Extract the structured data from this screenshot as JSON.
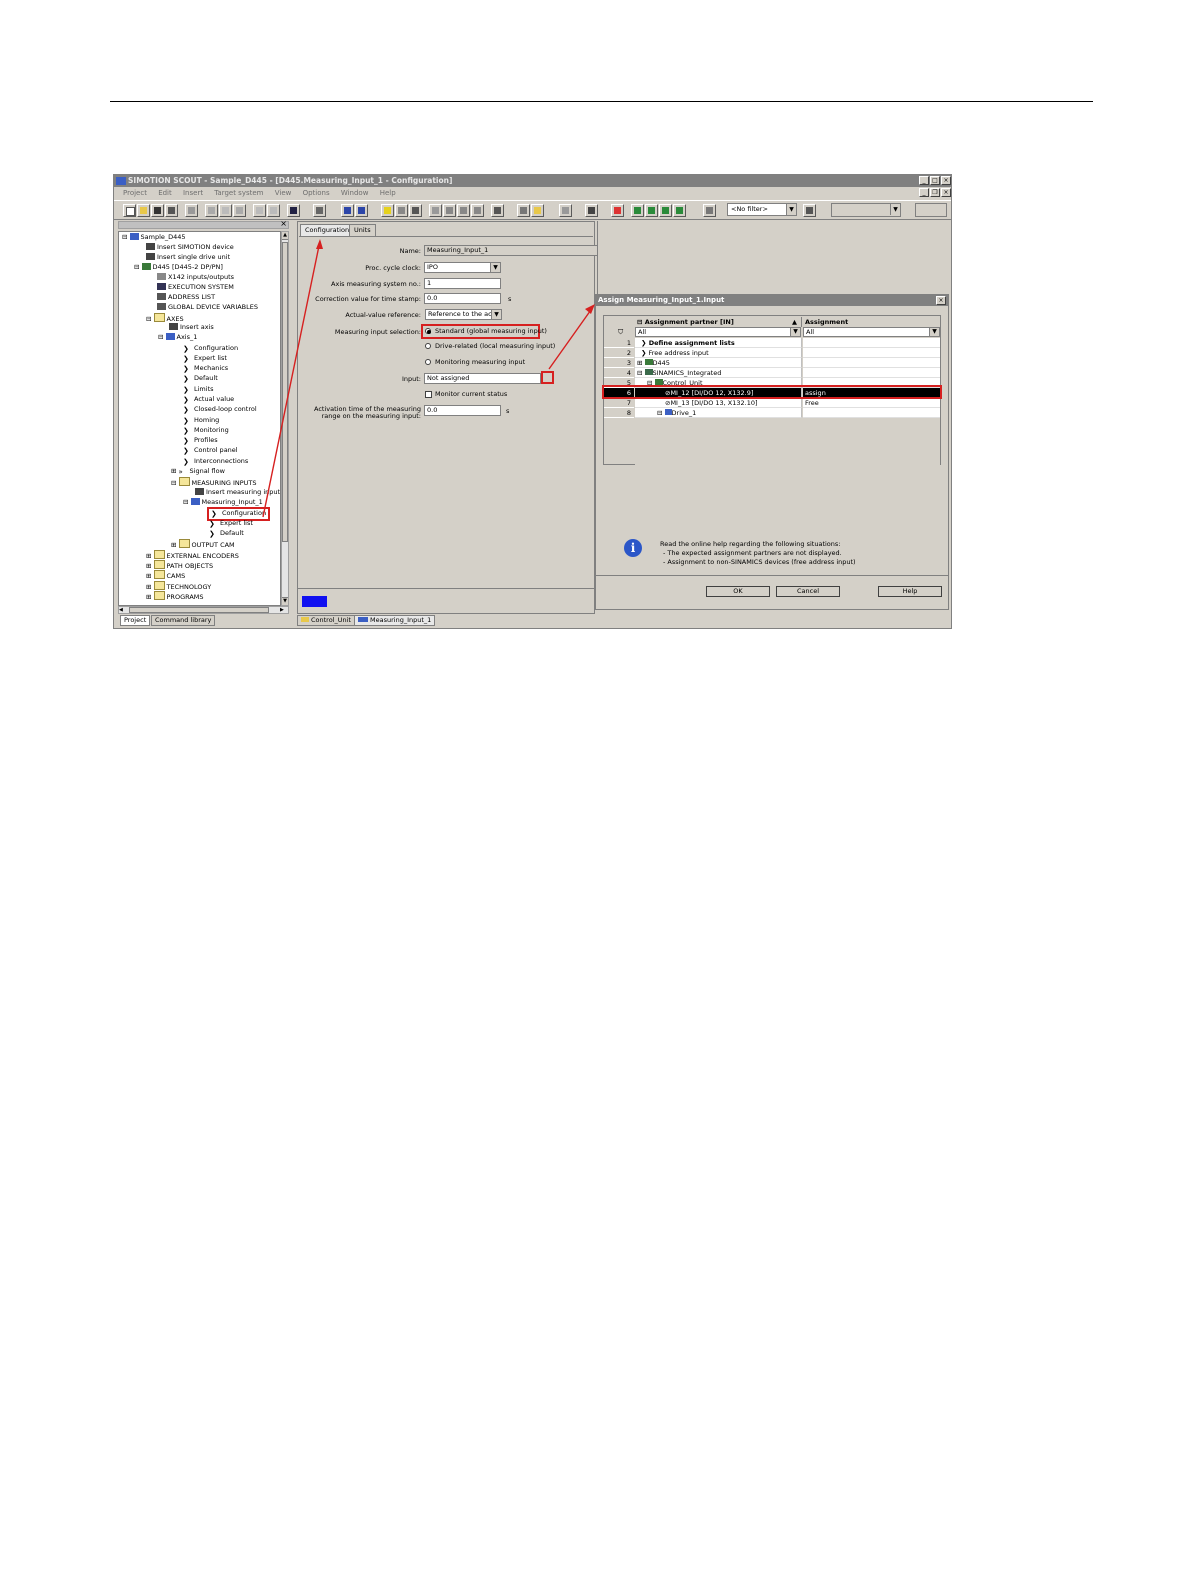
{
  "window": {
    "title": "SIMOTION SCOUT - Sample_D445 - [D445.Measuring_Input_1 - Configuration]",
    "menu": [
      "Project",
      "Edit",
      "Insert",
      "Target system",
      "View",
      "Options",
      "Window",
      "Help"
    ],
    "filter_value": "<No filter>"
  },
  "tree": {
    "items": [
      "Sample_D445",
      "Insert SIMOTION device",
      "Insert single drive unit",
      "D445 [D445-2 DP/PN]",
      "X142 inputs/outputs",
      "EXECUTION SYSTEM",
      "ADDRESS LIST",
      "GLOBAL DEVICE VARIABLES",
      "AXES",
      "Insert axis",
      "Axis_1",
      "Configuration",
      "Expert list",
      "Mechanics",
      "Default",
      "Limits",
      "Actual value",
      "Closed-loop control",
      "Homing",
      "Monitoring",
      "Profiles",
      "Control panel",
      "Interconnections",
      "Signal flow",
      "MEASURING INPUTS",
      "Insert measuring input",
      "Measuring_Input_1",
      "Configuration",
      "Expert list",
      "Default",
      "OUTPUT CAM",
      "EXTERNAL ENCODERS",
      "PATH OBJECTS",
      "CAMS",
      "TECHNOLOGY",
      "PROGRAMS"
    ],
    "tabs": [
      "Project",
      "Command library"
    ]
  },
  "config": {
    "tabs": [
      "Configuration",
      "Units"
    ],
    "name_label": "Name:",
    "name_value": "Measuring_Input_1",
    "proc_label": "Proc. cycle clock:",
    "proc_value": "IPO",
    "axis_label": "Axis measuring system no.:",
    "axis_value": "1",
    "corr_label": "Correction value for time stamp:",
    "corr_value": "0.0",
    "corr_unit": "s",
    "avr_label": "Actual-value reference:",
    "avr_value": "Reference to the actu",
    "mis_label": "Measuring input selection:",
    "radio_standard": "Standard (global measuring input)",
    "radio_drive": "Drive-related (local measuring input)",
    "radio_monitor": "Monitoring measuring input",
    "input_label": "Input:",
    "input_value": "Not assigned",
    "monitor_label": "Monitor current status",
    "act_label1": "Activation time of the measuring",
    "act_label2": "range on the measuring input:",
    "act_value": "0.0",
    "act_unit": "s"
  },
  "dialog": {
    "title": "Assign Measuring_Input_1.Input",
    "col1": "Assignment partner [IN]",
    "col2": "Assignment",
    "filter1": "All",
    "filter2": "All",
    "rows": [
      {
        "num": "1",
        "partner": "Define assignment lists",
        "assign": ""
      },
      {
        "num": "2",
        "partner": "Free address input",
        "assign": ""
      },
      {
        "num": "3",
        "partner": "D445",
        "assign": ""
      },
      {
        "num": "4",
        "partner": "SINAMICS_Integrated",
        "assign": ""
      },
      {
        "num": "5",
        "partner": "Control_Unit",
        "assign": ""
      },
      {
        "num": "6",
        "partner": "MI_12 [DI/DO 12, X132.9]",
        "assign": "assign"
      },
      {
        "num": "7",
        "partner": "MI_13 [DI/DO 13, X132.10]",
        "assign": "Free"
      },
      {
        "num": "8",
        "partner": "Drive_1",
        "assign": ""
      }
    ],
    "help_intro": "Read the online help regarding the following situations:",
    "help_line1": "- The expected assignment partners are not displayed.",
    "help_line2": "- Assignment to non-SINAMICS devices (free address input)",
    "ok": "OK",
    "cancel": "Cancel",
    "help": "Help"
  },
  "status": {
    "tabs": [
      "Control_Unit",
      "Measuring_Input_1"
    ]
  },
  "colors": {
    "highlight_red": "#d62020",
    "titlebar_gray": "#808080",
    "panel_bg": "#d4d0c8",
    "status_blue": "#1010f0"
  }
}
